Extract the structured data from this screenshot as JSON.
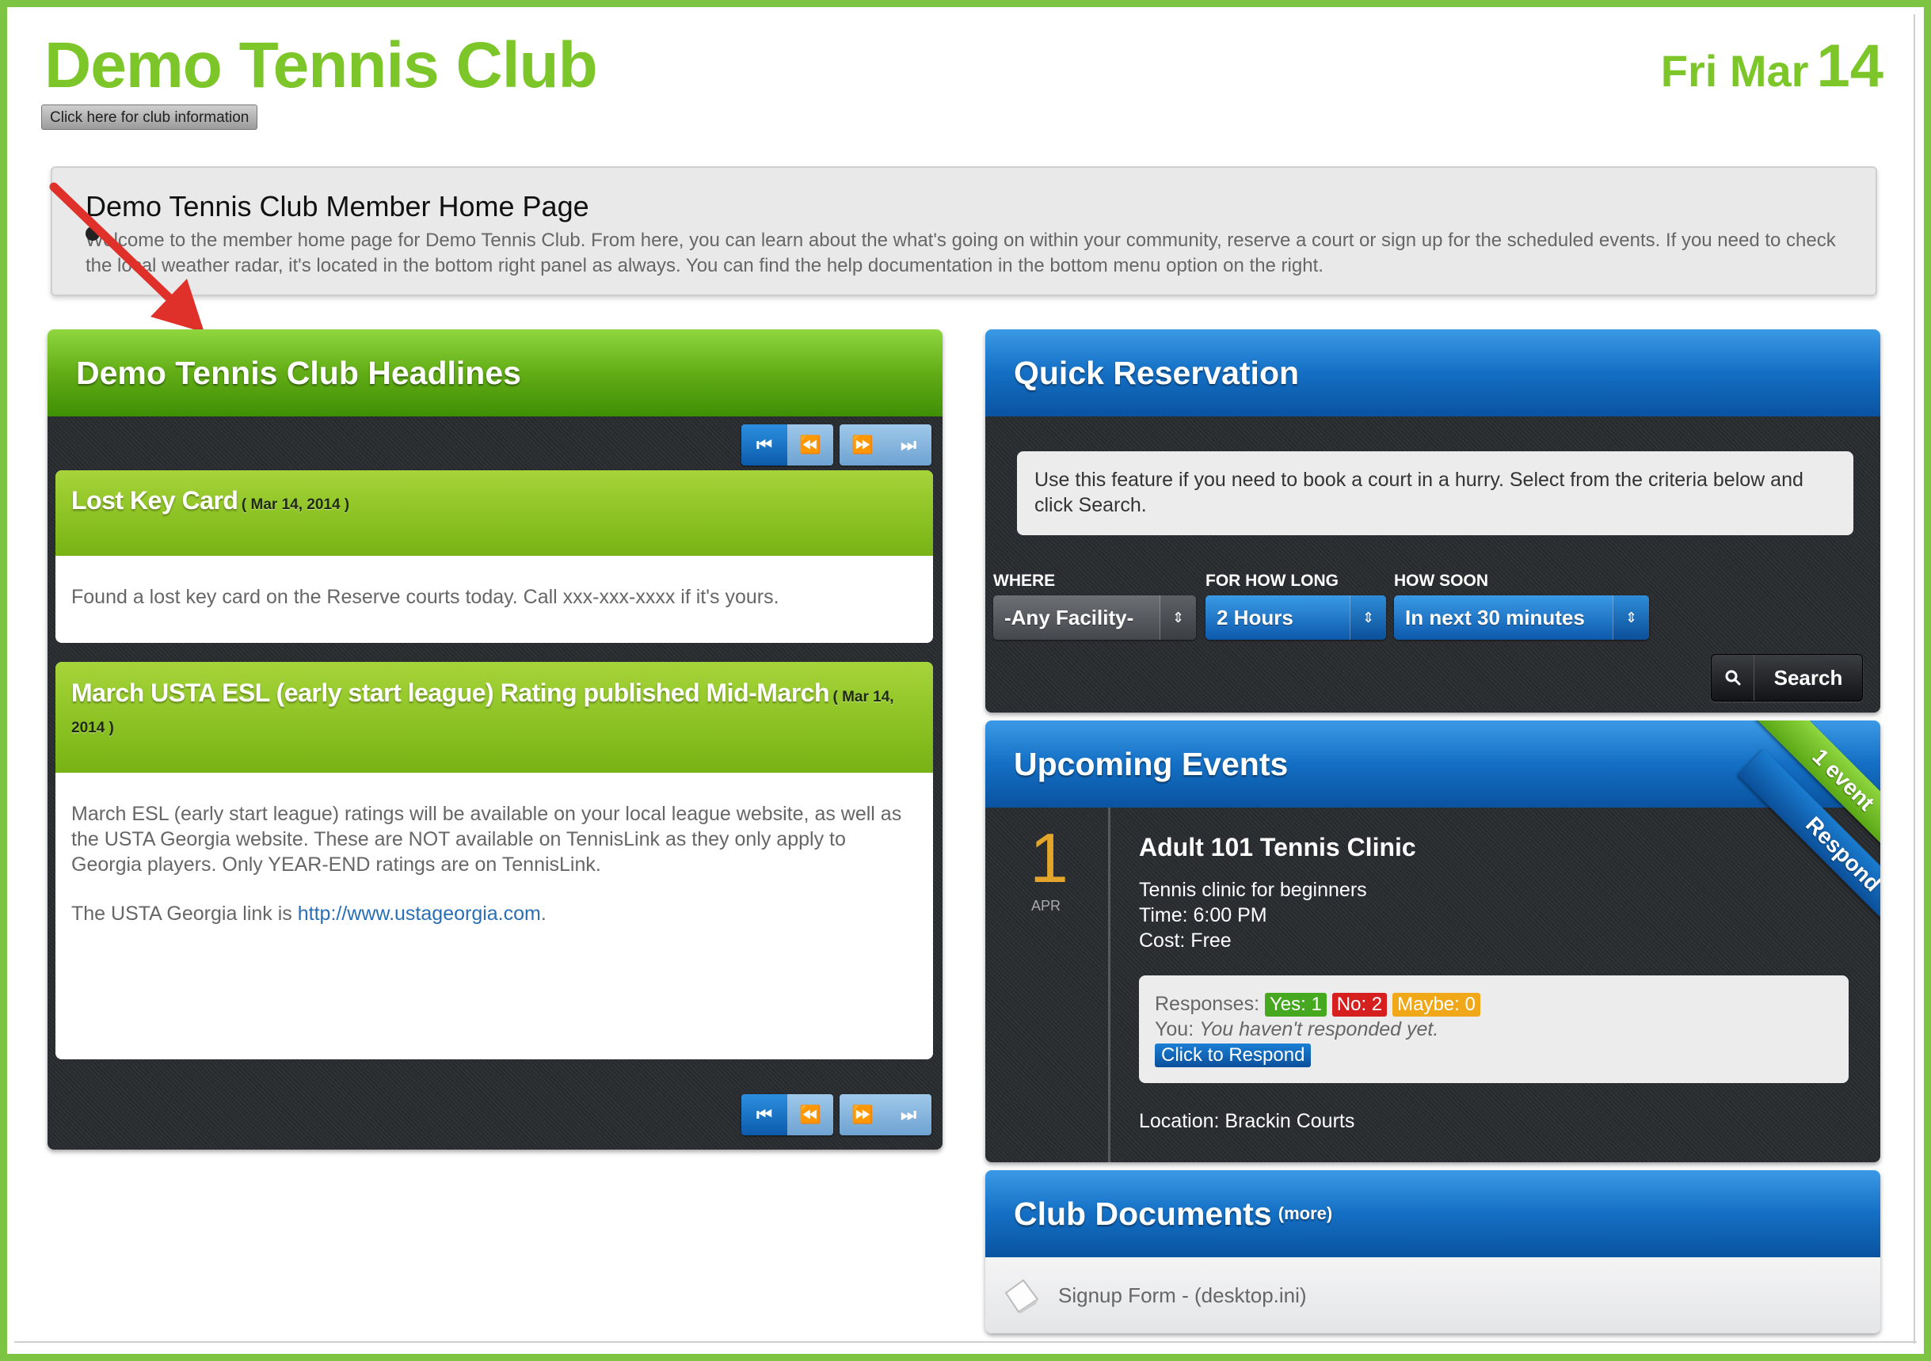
{
  "header": {
    "club_name": "Demo Tennis Club",
    "info_button": "Click here for club information",
    "date_day_month": "Fri Mar",
    "date_day": "14"
  },
  "welcome": {
    "title": "Demo Tennis Club Member Home Page",
    "text": "Welcome to the member home page for Demo Tennis Club. From here, you can learn about the what's going on within your community, reserve a court or sign up for the scheduled events. If you need to check the local weather radar, it's located in the bottom right panel as always. You can find the help documentation in the bottom menu option on the right."
  },
  "headlines": {
    "title": "Demo Tennis Club Headlines",
    "items": [
      {
        "title": "Lost Key Card",
        "date": "( Mar 14, 2014 )",
        "body": "Found a lost key card on the Reserve courts today. Call xxx-xxx-xxxx if it's yours."
      },
      {
        "title": "March USTA ESL (early start league) Rating published Mid-March",
        "date": "( Mar 14, 2014 )",
        "body": "March ESL (early start league) ratings will be available on your local league website, as well as the USTA Georgia website. These are NOT available on TennisLink as they only apply to Georgia players. Only YEAR-END ratings are on TennisLink.",
        "link_prefix": "The USTA Georgia link is ",
        "link_text": "http://www.ustageorgia.com",
        "link_suffix": "."
      }
    ]
  },
  "quick_reservation": {
    "title": "Quick Reservation",
    "note": "Use this feature if you need to book a court in a hurry. Select from the criteria below and click Search.",
    "where_label": "WHERE",
    "where_value": "-Any Facility-",
    "how_long_label": "FOR HOW LONG",
    "how_long_value": "2 Hours",
    "how_soon_label": "HOW SOON",
    "how_soon_value": "In next 30 minutes",
    "search_label": "Search"
  },
  "upcoming_events": {
    "title": "Upcoming Events",
    "ribbon_count": "1 event",
    "ribbon_action": "Respond",
    "event": {
      "day": "1",
      "month": "APR",
      "name": "Adult 101 Tennis Clinic",
      "description": "Tennis clinic for beginners",
      "time": "Time: 6:00 PM",
      "cost": "Cost: Free",
      "responses_label": "Responses:",
      "yes": "Yes: 1",
      "no": "No: 2",
      "maybe": "Maybe: 0",
      "you_label": "You:",
      "you_status": "You haven't responded yet.",
      "respond_button": "Click to Respond",
      "location": "Location: Brackin Courts"
    }
  },
  "club_documents": {
    "title": "Club Documents",
    "more": "(more)",
    "files": [
      "Signup Form - (desktop.ini)"
    ]
  },
  "colors": {
    "brand_green": "#7cc62a",
    "panel_blue": "#146fc4",
    "frame_green": "#7dc442",
    "annotation_red": "#e0302a"
  }
}
